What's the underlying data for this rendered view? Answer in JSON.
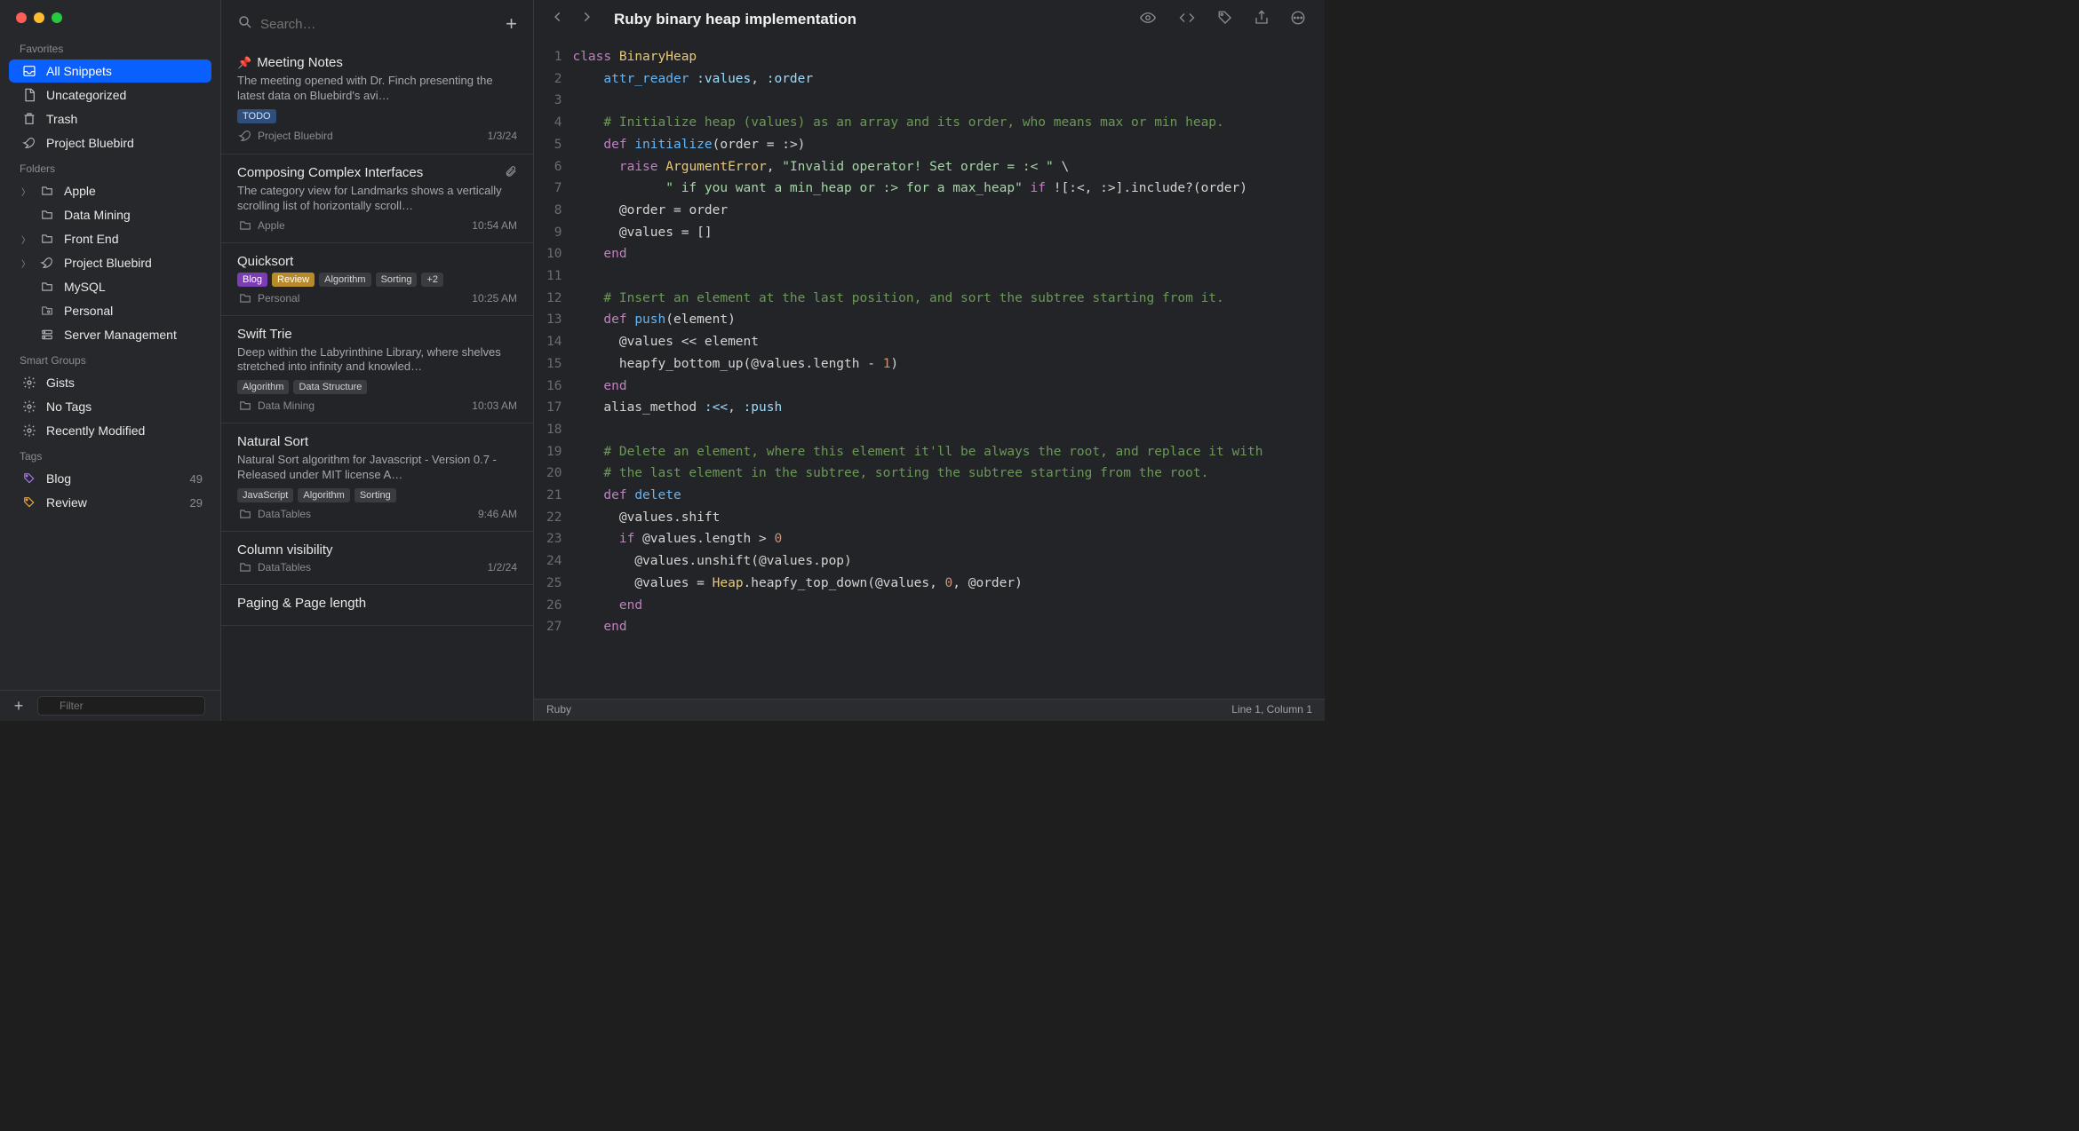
{
  "sidebar": {
    "sections": {
      "favorites": "Favorites",
      "folders": "Folders",
      "smart": "Smart Groups",
      "tags": "Tags"
    },
    "favorites": [
      {
        "id": "all-snippets",
        "label": "All Snippets",
        "icon": "tray",
        "active": true
      },
      {
        "id": "uncategorized",
        "label": "Uncategorized",
        "icon": "doc"
      },
      {
        "id": "trash",
        "label": "Trash",
        "icon": "trash"
      },
      {
        "id": "project-bluebird",
        "label": "Project Bluebird",
        "icon": "bird"
      }
    ],
    "folders": [
      {
        "id": "apple",
        "label": "Apple",
        "icon": "folder",
        "expandable": true
      },
      {
        "id": "data-mining",
        "label": "Data Mining",
        "icon": "folder"
      },
      {
        "id": "front-end",
        "label": "Front End",
        "icon": "folder",
        "expandable": true
      },
      {
        "id": "project-bluebird-folder",
        "label": "Project Bluebird",
        "icon": "bird",
        "expandable": true
      },
      {
        "id": "mysql",
        "label": "MySQL",
        "icon": "folder"
      },
      {
        "id": "personal",
        "label": "Personal",
        "icon": "folder-cog"
      },
      {
        "id": "server-management",
        "label": "Server Management",
        "icon": "server"
      }
    ],
    "smart": [
      {
        "id": "gists",
        "label": "Gists",
        "icon": "gear"
      },
      {
        "id": "no-tags",
        "label": "No Tags",
        "icon": "gear"
      },
      {
        "id": "recently-modified",
        "label": "Recently Modified",
        "icon": "gear"
      }
    ],
    "tags": [
      {
        "id": "blog",
        "label": "Blog",
        "count": "49",
        "color": "purple"
      },
      {
        "id": "review",
        "label": "Review",
        "count": "29",
        "color": "orange"
      }
    ],
    "filter_placeholder": "Filter"
  },
  "notelist": {
    "search_placeholder": "Search…",
    "items": [
      {
        "id": "meeting-notes",
        "pinned": true,
        "title": "Meeting Notes",
        "preview": "The meeting opened with Dr. Finch presenting the latest data on Bluebird's avi…",
        "tags": [
          {
            "text": "TODO",
            "class": "todo"
          }
        ],
        "folder": "Project Bluebird",
        "folder_icon": "bird",
        "date": "1/3/24"
      },
      {
        "id": "composing",
        "title": "Composing Complex Interfaces",
        "attachment": true,
        "preview": "The category view for Landmarks shows a vertically scrolling list of horizontally scroll…",
        "tags": [],
        "folder": "Apple",
        "folder_icon": "folder",
        "date": "10:54 AM"
      },
      {
        "id": "quicksort",
        "title": "Quicksort",
        "preview": "",
        "tags": [
          {
            "text": "Blog",
            "class": "blog"
          },
          {
            "text": "Review",
            "class": "review"
          },
          {
            "text": "Algorithm",
            "class": ""
          },
          {
            "text": "Sorting",
            "class": ""
          },
          {
            "text": "+2",
            "class": ""
          }
        ],
        "folder": "Personal",
        "folder_icon": "folder",
        "date": "10:25 AM"
      },
      {
        "id": "swift-trie",
        "title": "Swift Trie",
        "preview": "Deep within the Labyrinthine Library, where shelves stretched into infinity and knowled…",
        "tags": [
          {
            "text": "Algorithm",
            "class": ""
          },
          {
            "text": "Data Structure",
            "class": ""
          }
        ],
        "folder": "Data Mining",
        "folder_icon": "folder",
        "date": "10:03 AM"
      },
      {
        "id": "natural-sort",
        "title": "Natural Sort",
        "preview": "Natural Sort algorithm for Javascript - Version 0.7 - Released under MIT license A…",
        "tags": [
          {
            "text": "JavaScript",
            "class": ""
          },
          {
            "text": "Algorithm",
            "class": ""
          },
          {
            "text": "Sorting",
            "class": ""
          }
        ],
        "folder": "DataTables",
        "folder_icon": "folder",
        "date": "9:46 AM"
      },
      {
        "id": "column-visibility",
        "title": "Column visibility",
        "preview": "",
        "tags": [],
        "folder": "DataTables",
        "folder_icon": "folder",
        "date": "1/2/24"
      },
      {
        "id": "paging",
        "title": "Paging & Page length",
        "preview": "",
        "tags": [],
        "folder": "",
        "date": ""
      }
    ]
  },
  "editor": {
    "title": "Ruby binary heap implementation",
    "language": "Ruby",
    "cursor": "Line 1, Column 1",
    "code_lines": [
      {
        "n": 1,
        "tokens": [
          [
            "kw",
            "class"
          ],
          [
            "sp",
            " "
          ],
          [
            "cls",
            "BinaryHeap"
          ]
        ]
      },
      {
        "n": 2,
        "tokens": [
          [
            "sp",
            "    "
          ],
          [
            "def",
            "attr_reader"
          ],
          [
            "sp",
            " "
          ],
          [
            "sym",
            ":values"
          ],
          [
            "op",
            ", "
          ],
          [
            "sym",
            ":order"
          ]
        ]
      },
      {
        "n": 3,
        "tokens": []
      },
      {
        "n": 4,
        "tokens": [
          [
            "sp",
            "    "
          ],
          [
            "com",
            "# Initialize heap (values) as an array and its order, who means max or min heap."
          ]
        ]
      },
      {
        "n": 5,
        "tokens": [
          [
            "sp",
            "    "
          ],
          [
            "kw",
            "def"
          ],
          [
            "sp",
            " "
          ],
          [
            "def",
            "initialize"
          ],
          [
            "op",
            "(order = :>)"
          ]
        ]
      },
      {
        "n": 6,
        "tokens": [
          [
            "sp",
            "      "
          ],
          [
            "kw",
            "raise"
          ],
          [
            "sp",
            " "
          ],
          [
            "const",
            "ArgumentError"
          ],
          [
            "op",
            ", "
          ],
          [
            "str",
            "\"Invalid operator! Set order = :< \""
          ],
          [
            "op",
            " \\"
          ]
        ]
      },
      {
        "n": 7,
        "tokens": [
          [
            "sp",
            "            "
          ],
          [
            "str",
            "\" if you want a min_heap or :> for a max_heap\""
          ],
          [
            "sp",
            " "
          ],
          [
            "kw",
            "if"
          ],
          [
            "sp",
            " "
          ],
          [
            "op",
            "![:<, :>].include?(order)"
          ]
        ]
      },
      {
        "n": 8,
        "tokens": [
          [
            "sp",
            "      "
          ],
          [
            "ivar",
            "@order"
          ],
          [
            "op",
            " = order"
          ]
        ]
      },
      {
        "n": 9,
        "tokens": [
          [
            "sp",
            "      "
          ],
          [
            "ivar",
            "@values"
          ],
          [
            "op",
            " = []"
          ]
        ]
      },
      {
        "n": 10,
        "tokens": [
          [
            "sp",
            "    "
          ],
          [
            "kw",
            "end"
          ]
        ]
      },
      {
        "n": 11,
        "tokens": []
      },
      {
        "n": 12,
        "tokens": [
          [
            "sp",
            "    "
          ],
          [
            "com",
            "# Insert an element at the last position, and sort the subtree starting from it."
          ]
        ]
      },
      {
        "n": 13,
        "tokens": [
          [
            "sp",
            "    "
          ],
          [
            "kw",
            "def"
          ],
          [
            "sp",
            " "
          ],
          [
            "def",
            "push"
          ],
          [
            "op",
            "(element)"
          ]
        ]
      },
      {
        "n": 14,
        "tokens": [
          [
            "sp",
            "      "
          ],
          [
            "ivar",
            "@values"
          ],
          [
            "op",
            " << element"
          ]
        ]
      },
      {
        "n": 15,
        "tokens": [
          [
            "sp",
            "      "
          ],
          [
            "op",
            "heapfy_bottom_up("
          ],
          [
            "ivar",
            "@values"
          ],
          [
            "op",
            ".length - "
          ],
          [
            "num",
            "1"
          ],
          [
            "op",
            ")"
          ]
        ]
      },
      {
        "n": 16,
        "tokens": [
          [
            "sp",
            "    "
          ],
          [
            "kw",
            "end"
          ]
        ]
      },
      {
        "n": 17,
        "tokens": [
          [
            "sp",
            "    "
          ],
          [
            "op",
            "alias_method "
          ],
          [
            "sym",
            ":<<"
          ],
          [
            "op",
            ", "
          ],
          [
            "sym",
            ":push"
          ]
        ]
      },
      {
        "n": 18,
        "tokens": []
      },
      {
        "n": 19,
        "tokens": [
          [
            "sp",
            "    "
          ],
          [
            "com",
            "# Delete an element, where this element it'll be always the root, and replace it with"
          ]
        ]
      },
      {
        "n": 20,
        "tokens": [
          [
            "sp",
            "    "
          ],
          [
            "com",
            "# the last element in the subtree, sorting the subtree starting from the root."
          ]
        ]
      },
      {
        "n": 21,
        "tokens": [
          [
            "sp",
            "    "
          ],
          [
            "kw",
            "def"
          ],
          [
            "sp",
            " "
          ],
          [
            "def",
            "delete"
          ]
        ]
      },
      {
        "n": 22,
        "tokens": [
          [
            "sp",
            "      "
          ],
          [
            "ivar",
            "@values"
          ],
          [
            "op",
            ".shift"
          ]
        ]
      },
      {
        "n": 23,
        "tokens": [
          [
            "sp",
            "      "
          ],
          [
            "kw",
            "if"
          ],
          [
            "sp",
            " "
          ],
          [
            "ivar",
            "@values"
          ],
          [
            "op",
            ".length > "
          ],
          [
            "num",
            "0"
          ]
        ]
      },
      {
        "n": 24,
        "tokens": [
          [
            "sp",
            "        "
          ],
          [
            "ivar",
            "@values"
          ],
          [
            "op",
            ".unshift("
          ],
          [
            "ivar",
            "@values"
          ],
          [
            "op",
            ".pop)"
          ]
        ]
      },
      {
        "n": 25,
        "tokens": [
          [
            "sp",
            "        "
          ],
          [
            "ivar",
            "@values"
          ],
          [
            "op",
            " = "
          ],
          [
            "const",
            "Heap"
          ],
          [
            "op",
            ".heapfy_top_down("
          ],
          [
            "ivar",
            "@values"
          ],
          [
            "op",
            ", "
          ],
          [
            "num",
            "0"
          ],
          [
            "op",
            ", "
          ],
          [
            "ivar",
            "@order"
          ],
          [
            "op",
            ")"
          ]
        ]
      },
      {
        "n": 26,
        "tokens": [
          [
            "sp",
            "      "
          ],
          [
            "kw",
            "end"
          ]
        ]
      },
      {
        "n": 27,
        "tokens": [
          [
            "sp",
            "    "
          ],
          [
            "kw",
            "end"
          ]
        ]
      }
    ]
  }
}
